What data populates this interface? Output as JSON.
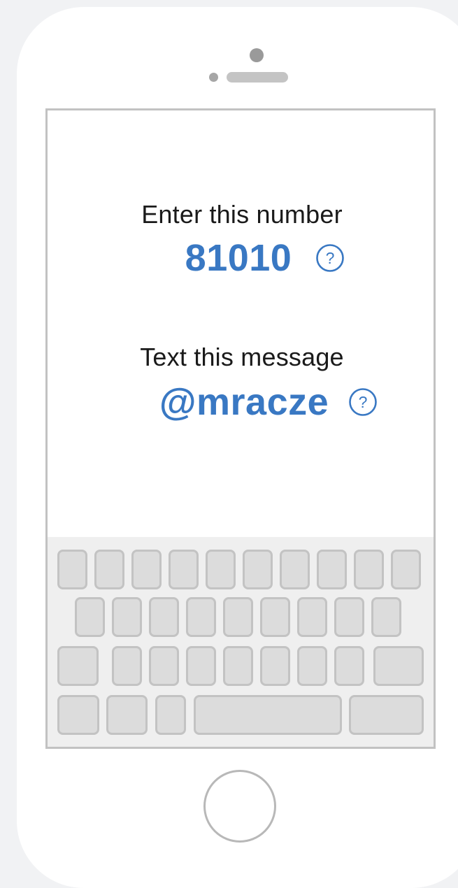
{
  "instructions": {
    "number_label": "Enter this number",
    "number_value": "81010",
    "message_label": "Text this message",
    "message_value": "@mracze",
    "help_glyph": "?"
  },
  "icons": {
    "help": "question-circle-icon",
    "home": "home-button"
  },
  "colors": {
    "accent": "#3978c3",
    "text": "#1a1a1a",
    "key_fill": "#dcdcdc",
    "key_border": "#c3c3c3",
    "page_background": "#f1f2f4"
  },
  "keyboard": {
    "rows": [
      10,
      9,
      9,
      4
    ]
  }
}
